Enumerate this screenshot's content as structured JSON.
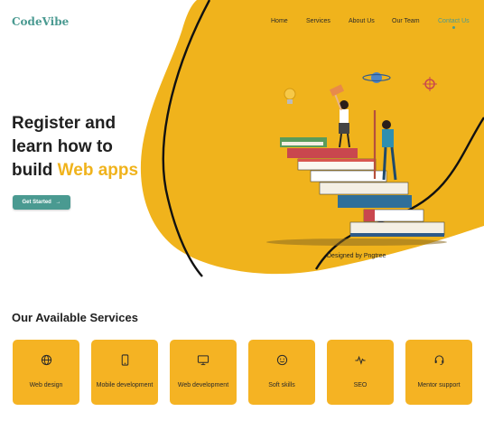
{
  "brand": {
    "logo": "CodeVibe",
    "accent": "#4a9a91",
    "yellow": "#f5b323"
  },
  "nav": {
    "items": [
      {
        "label": "Home"
      },
      {
        "label": "Services"
      },
      {
        "label": "About Us"
      },
      {
        "label": "Our Team"
      },
      {
        "label": "Contact Us",
        "active": true
      }
    ]
  },
  "hero": {
    "line1": "Register and",
    "line2": "learn how to",
    "line3_prefix": "build ",
    "line3_accent": "Web apps",
    "cta_label": "Get Started",
    "cta_arrow": "→",
    "illustration_credit": "Designed by Pngtree"
  },
  "services": {
    "title": "Our Available Services",
    "items": [
      {
        "icon": "globe-icon",
        "label": "Web design"
      },
      {
        "icon": "mobile-icon",
        "label": "Mobile development"
      },
      {
        "icon": "monitor-icon",
        "label": "Web development"
      },
      {
        "icon": "smile-icon",
        "label": "Soft skills"
      },
      {
        "icon": "pulse-icon",
        "label": "SEO"
      },
      {
        "icon": "headset-icon",
        "label": "Mentor support"
      }
    ]
  }
}
